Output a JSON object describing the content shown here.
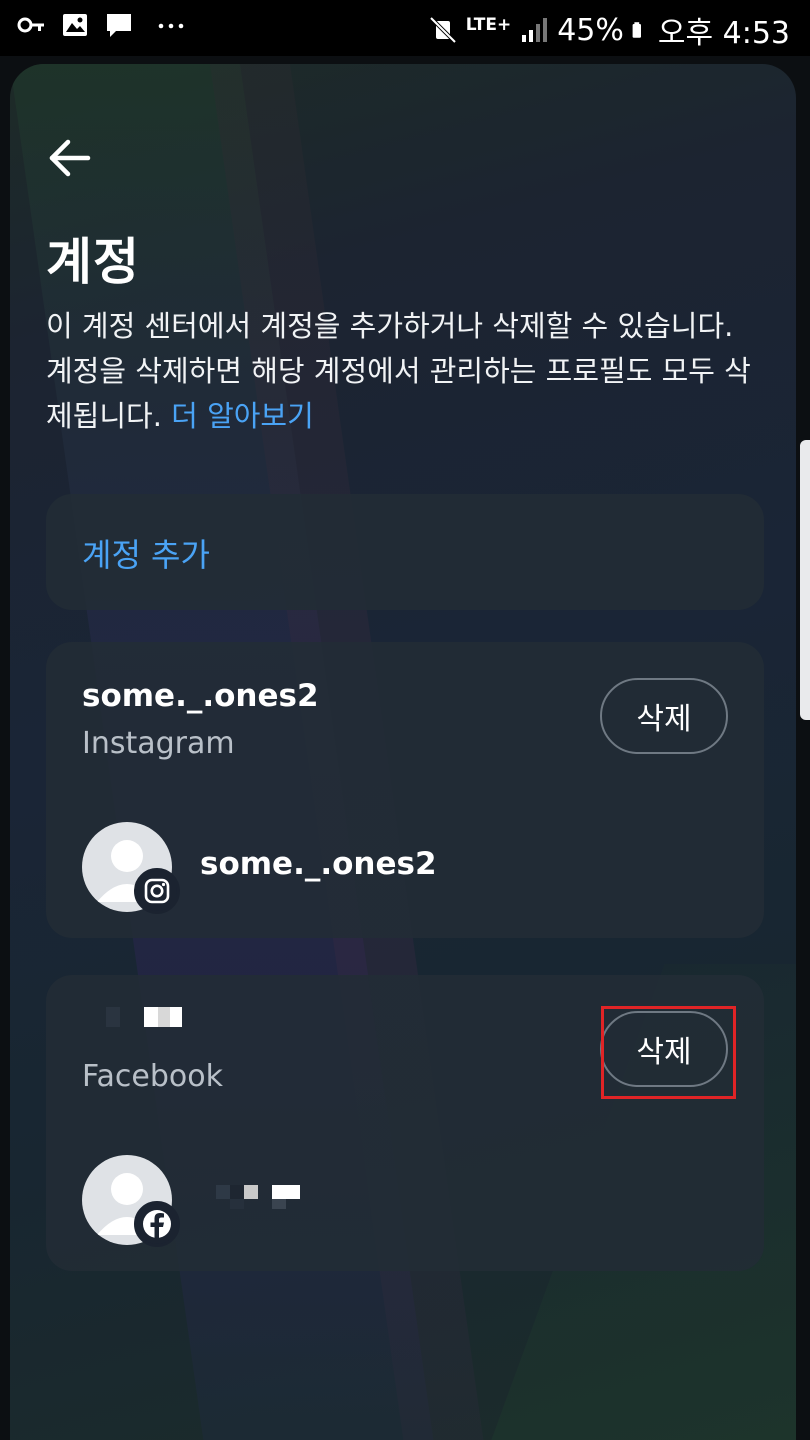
{
  "status_bar": {
    "left_icons": [
      "key-icon",
      "image-icon",
      "chat-icon",
      "more-dots-icon"
    ],
    "network": "LTE+",
    "battery_percent": "45%",
    "time": "오후 4:53"
  },
  "header": {
    "title": "계정",
    "description": "이 계정 센터에서 계정을 추가하거나 삭제할 수 있습니다. 계정을 삭제하면 해당 계정에서 관리하는 프로필도 모두 삭제됩니다.",
    "learn_more": "더 알아보기"
  },
  "add_account": {
    "label": "계정 추가"
  },
  "accounts": [
    {
      "name": "some._.ones2",
      "platform": "Instagram",
      "delete_label": "삭제",
      "profile_name": "some._.ones2",
      "badge_icon": "instagram-icon"
    },
    {
      "name": "",
      "platform": "Facebook",
      "delete_label": "삭제",
      "profile_name": "",
      "badge_icon": "facebook-icon",
      "highlighted": true
    }
  ],
  "colors": {
    "accent": "#4aa3f5",
    "highlight": "#e02426"
  }
}
